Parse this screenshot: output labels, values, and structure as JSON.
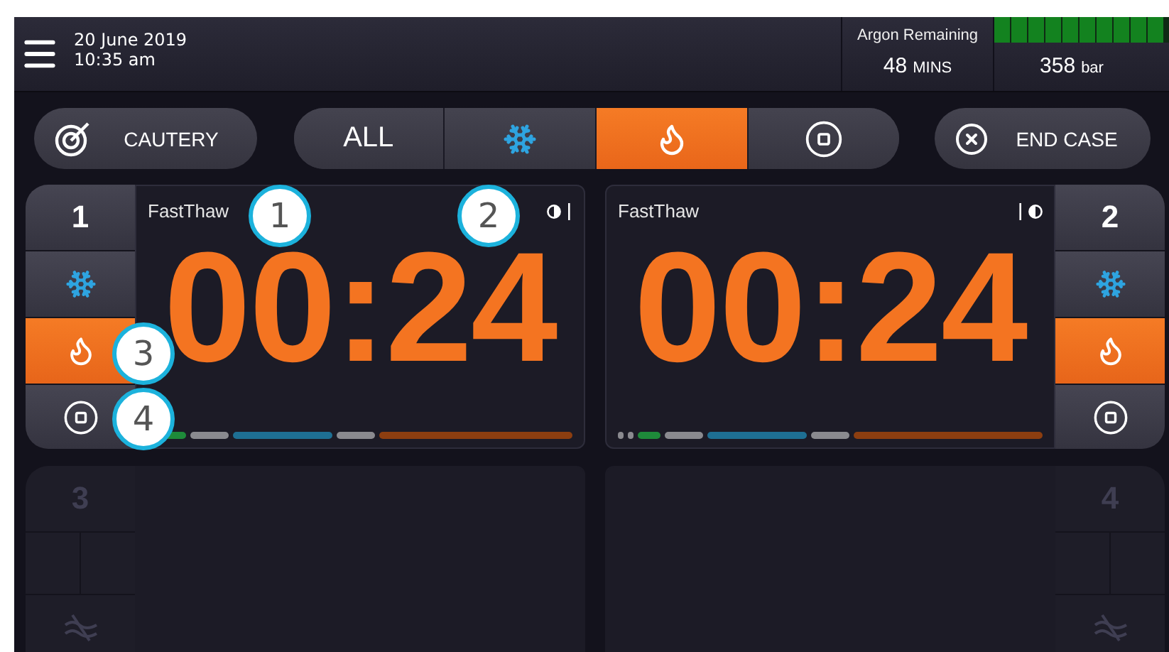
{
  "header": {
    "date": "20 June 2019",
    "time": "10:35 am",
    "argon": {
      "label": "Argon Remaining",
      "value": "48",
      "unit": "MINS"
    },
    "tank": {
      "value": "358",
      "unit": "bar",
      "level": 1
    }
  },
  "toolbar": {
    "cautery": "CAUTERY",
    "modes": [
      {
        "kind": "all",
        "label": "ALL",
        "selected": false
      },
      {
        "kind": "freeze",
        "selected": false
      },
      {
        "kind": "heat",
        "selected": true
      },
      {
        "kind": "stop",
        "selected": false
      }
    ],
    "end_case": "END CASE"
  },
  "probes": [
    {
      "number": "1",
      "active": true,
      "mode": "FastThaw",
      "timer": "00:24",
      "controls": [
        {
          "kind": "freeze",
          "selected": false
        },
        {
          "kind": "heat",
          "selected": true
        },
        {
          "kind": "stop",
          "selected": false
        }
      ],
      "segments": [
        {
          "kind": "medium",
          "color": "#1e8a3a"
        },
        {
          "kind": "medium",
          "color": "#8a8a8f"
        },
        {
          "kind": "long",
          "color": "#1e6f93"
        },
        {
          "kind": "medium",
          "color": "#8a8a8f"
        },
        {
          "kind": "xlong",
          "color": "#8c3e10"
        }
      ]
    },
    {
      "number": "2",
      "active": true,
      "mode": "FastThaw",
      "timer": "00:24",
      "controls": [
        {
          "kind": "freeze",
          "selected": false
        },
        {
          "kind": "heat",
          "selected": true
        },
        {
          "kind": "stop",
          "selected": false
        }
      ],
      "segments": [
        {
          "kind": "tick",
          "color": "#8a8a8f"
        },
        {
          "kind": "tick",
          "color": "#8a8a8f"
        },
        {
          "kind": "short",
          "color": "#1e8a3a"
        },
        {
          "kind": "medium",
          "color": "#8a8a8f"
        },
        {
          "kind": "long",
          "color": "#1e6f93"
        },
        {
          "kind": "medium",
          "color": "#8a8a8f"
        },
        {
          "kind": "xlong",
          "color": "#8c3e10"
        }
      ]
    },
    {
      "number": "3",
      "active": false
    },
    {
      "number": "4",
      "active": false
    }
  ],
  "callouts": [
    {
      "label": "1"
    },
    {
      "label": "2"
    },
    {
      "label": "3"
    },
    {
      "label": "4"
    }
  ]
}
